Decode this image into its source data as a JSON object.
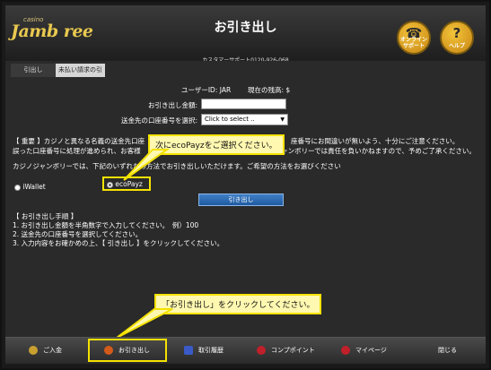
{
  "header": {
    "logo_small": "casino",
    "logo_main": "Jamb  ree",
    "title": "お引き出し",
    "support": "カスタマーサポート0120-926-068",
    "online_support": {
      "glyph": "☎",
      "label_1": "オンライン",
      "label_2": "サポート"
    },
    "help": {
      "glyph": "?",
      "label": "ヘルプ"
    }
  },
  "tabs": [
    {
      "label": "引出し"
    },
    {
      "label": "未払い請求の引出し"
    }
  ],
  "account": {
    "user_id_label": "ユーザーID: JAR",
    "balance_label": "現在の残高: $"
  },
  "form": {
    "amount_label": "お引き出し金額:",
    "account_label": "送金先の口座番号を選択:",
    "account_select": "Click to select ..",
    "amount_value": ""
  },
  "notice": {
    "line1_left": "【 重要 】カジノと異なる名義の送金先口座",
    "line1_right": "座番号にお間違いが無いよう、十分にご注意ください。",
    "line2_left": "誤った口座番号に処理が進められ、お客様",
    "line2_right": "ジャンボリーでは責任を負いかねますので、予めご了承ください。",
    "line3": "カジノジャンボリーでは、下記のいずれかの方法でお引き出しいただけます。ご希望の方法をお選びください"
  },
  "methods": [
    {
      "label": "iWallet",
      "selected": false
    },
    {
      "label": "ecoPayz",
      "selected": true
    }
  ],
  "withdraw_button": "引き出し",
  "steps": {
    "title": "【 お引き出し手順 】",
    "items": [
      "1. お引き出し金額を半角数字で入力してください。　例）100",
      "2. 送金先の口座番号を選択してください。",
      "3. 入力内容をお確かめの上、【 引き出し 】をクリックしてください。"
    ]
  },
  "callouts": {
    "top": "次にecoPayzをご選択ください。",
    "bottom": "「お引き出し」をクリックしてください。"
  },
  "bottom_nav": [
    {
      "label": "ご入金",
      "icon": "deposit-icon",
      "color": "#c8a030"
    },
    {
      "label": "お引き出し",
      "icon": "withdraw-icon",
      "color": "#d35a1a"
    },
    {
      "label": "取引履歴",
      "icon": "history-icon",
      "color": "#3a5ac8"
    },
    {
      "label": "コンプポイント",
      "icon": "comp-point-icon",
      "color": "#c0202a"
    },
    {
      "label": "マイページ",
      "icon": "mypage-icon",
      "color": "#c0202a"
    },
    {
      "label": "閉じる",
      "icon": "",
      "color": ""
    }
  ],
  "colors": {
    "highlight": "#f4e200",
    "accent": "#f4c43a",
    "button": "#1f5aa0"
  }
}
